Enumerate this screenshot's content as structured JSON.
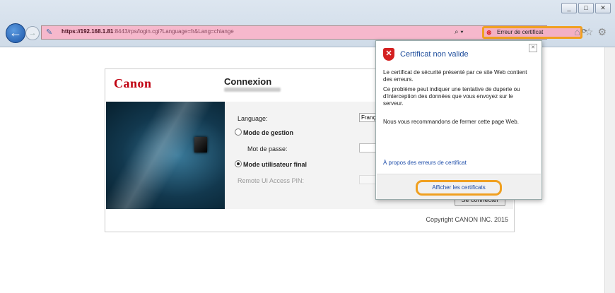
{
  "browser": {
    "url_host": "https://192.168.1.81",
    "url_path": ":8443/rps/login.cgi?Language=fr&Lang=chiange",
    "cert_error_label": "Erreur de certificat",
    "search_icon": "search-icon",
    "window_buttons": [
      "_",
      "□",
      "✕"
    ]
  },
  "page": {
    "logo": "Canon",
    "title": "Connexion",
    "language_label": "Language:",
    "language_value": "Franç",
    "mode_admin_label": "Mode de gestion",
    "password_label": "Mot de passe:",
    "mode_user_label": "Mode utilisateur final",
    "pin_label": "Remote UI Access PIN:",
    "connect_button": "Se connecter",
    "copyright": "Copyright CANON INC. 2015"
  },
  "popup": {
    "title": "Certificat non valide",
    "para1": "Le certificat de sécurité présenté par ce site Web contient des erreurs.",
    "para2": "Ce problème peut indiquer une tentative de duperie ou d'interception des données que vous envoyez sur le serveur.",
    "para3": "Nous vous recommandons de fermer cette page Web.",
    "about_link": "À propos des erreurs de certificat",
    "view_certs": "Afficher les certificats"
  },
  "colors": {
    "accent": "#f0a020",
    "brand": "#c00010",
    "address_error": "#f6b8cc"
  }
}
